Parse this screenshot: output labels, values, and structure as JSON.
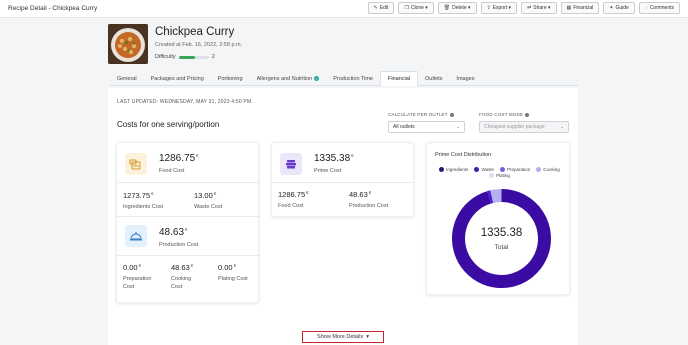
{
  "page": {
    "title": "Recipe Detail - Chickpea Curry"
  },
  "toolbar": [
    {
      "label": "Edit",
      "icon": "edit-icon",
      "glyph": "✎",
      "name": "edit-button"
    },
    {
      "label": "Clone ▾",
      "icon": "clone-icon",
      "glyph": "❐",
      "name": "clone-button"
    },
    {
      "label": "Delete ▾",
      "icon": "trash-icon",
      "glyph": "🗑",
      "name": "delete-button"
    },
    {
      "label": "Export ▾",
      "icon": "export-icon",
      "glyph": "⇪",
      "name": "export-button"
    },
    {
      "label": "Share ▾",
      "icon": "share-icon",
      "glyph": "⇄",
      "name": "share-button"
    },
    {
      "label": "Financial",
      "icon": "calculator-icon",
      "glyph": "▦",
      "name": "financial-button"
    },
    {
      "label": "Guide",
      "icon": "wand-icon",
      "glyph": "✦",
      "name": "guide-button"
    },
    {
      "label": "Comments",
      "icon": "comment-icon",
      "glyph": "◌",
      "name": "comments-button"
    }
  ],
  "recipe": {
    "name": "Chickpea Curry",
    "created": "Created at Feb. 16, 2022, 2:58 p.m.",
    "difficulty_label": "Difficulty",
    "difficulty_value": "2",
    "difficulty_fraction": 0.55
  },
  "tabs": [
    {
      "label": "General"
    },
    {
      "label": "Packages and Pricing"
    },
    {
      "label": "Portioning"
    },
    {
      "label": "Allergens and Nutrition",
      "check": true
    },
    {
      "label": "Production Time"
    },
    {
      "label": "Financial",
      "active": true
    },
    {
      "label": "Outlets"
    },
    {
      "label": "Images"
    }
  ],
  "financial": {
    "last_updated": "LAST UPDATED: WEDNESDAY, MAY 31, 2023 4:50 PM.",
    "section_title": "Costs for one serving/portion",
    "calc_label": "CALCULATE PER OUTLET",
    "calc_value": "All outlets",
    "mode_label": "FOOD COST MODE",
    "mode_value": "Cheapest supplier package",
    "currency": "€",
    "food_cost": {
      "value": "1286.75",
      "label": "Food Cost"
    },
    "ingredients_cost": {
      "value": "1273.75",
      "label": "Ingredients Cost"
    },
    "waste_cost": {
      "value": "13.00",
      "label": "Waste Cost"
    },
    "production_cost": {
      "value": "48.63",
      "label": "Production Cost"
    },
    "preparation_cost": {
      "value": "0.00",
      "label": "Preparation Cost"
    },
    "cooking_cost": {
      "value": "48.63",
      "label": "Cooking Cost"
    },
    "plating_cost": {
      "value": "0.00",
      "label": "Plating Cost"
    },
    "prime_cost": {
      "value": "1335.38",
      "label": "Prime Cost"
    },
    "prime_food_cost": {
      "value": "1286.75",
      "label": "Food Cost"
    },
    "prime_production_cost": {
      "value": "48.63",
      "label": "Production Cost"
    }
  },
  "distribution": {
    "title": "Prime Cost Distribution",
    "legend": [
      {
        "label": "Ingredients",
        "color": "#1d1b6e"
      },
      {
        "label": "Waste",
        "color": "#3f1fb0"
      },
      {
        "label": "Preparation",
        "color": "#7b5ce0"
      },
      {
        "label": "Cooking",
        "color": "#b9aef0"
      },
      {
        "label": "Plating",
        "color": "#dedaf6"
      }
    ],
    "total_value": "1335.38",
    "total_label": "Total",
    "segments": [
      {
        "label": "Ingredients",
        "value": 1273.75,
        "color": "#3a0ca3"
      },
      {
        "label": "Waste",
        "value": 13.0,
        "color": "#4a1bd0"
      },
      {
        "label": "Preparation",
        "value": 0.0,
        "color": "#7b5ce0"
      },
      {
        "label": "Cooking",
        "value": 48.63,
        "color": "#b9aef0"
      },
      {
        "label": "Plating",
        "value": 0.0,
        "color": "#dedaf6"
      }
    ]
  },
  "show_more": "Show More Details"
}
